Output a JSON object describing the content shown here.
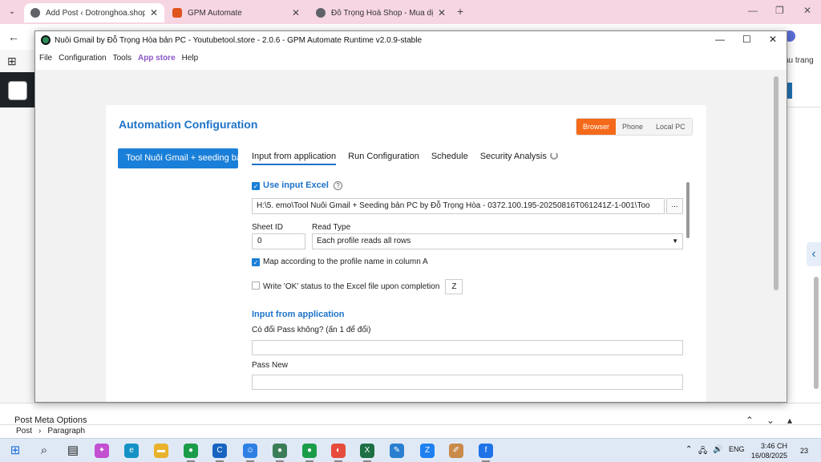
{
  "browser": {
    "tabs": [
      {
        "title": "Add Post ‹ Dotronghoa.shop —",
        "icon_color": "#5f6368",
        "active": true
      },
      {
        "title": "GPM Automate",
        "icon_color": "#e0541d",
        "active": false
      },
      {
        "title": "Đỗ Trọng Hoà Shop - Mua dịch",
        "icon_color": "#5f6368",
        "active": false
      }
    ],
    "new_tab": "+",
    "minimize": "—",
    "maximize": "❐",
    "close": "✕",
    "right_text": "ầu trang"
  },
  "app": {
    "title": "Nuôi Gmail by Đỗ Trọng Hòa bản PC - Youtubetool.store  - 2.0.6 - GPM Automate Runtime v2.0.9-stable",
    "menu": [
      "File",
      "Configuration",
      "Tools",
      "App store",
      "Help"
    ],
    "card_title": "Automation Configuration",
    "modes": [
      {
        "label": "Browser",
        "active": true
      },
      {
        "label": "Phone",
        "active": false
      },
      {
        "label": "Local PC",
        "active": false
      }
    ],
    "tool_button": "Tool Nuôi Gmail + seeding bả",
    "tabs": [
      "Input from application",
      "Run Configuration",
      "Schedule",
      "Security Analysis"
    ],
    "use_excel_label": "Use input Excel",
    "use_excel_checked": true,
    "file_path": "H:\\5. emo\\Tool Nuôi Gmail + Seeding bản PC by Đỗ Trọng Hòa - 0372.100.195-20250816T061241Z-1-001\\Too",
    "browse_button": "...",
    "sheet_id_label": "Sheet ID",
    "sheet_id_value": "0",
    "read_type_label": "Read Type",
    "read_type_value": "Each profile reads all rows",
    "map_label": "Map according to the profile name in column A",
    "map_checked": true,
    "write_ok_label": "Write 'OK' status to the Excel file upon completion",
    "write_ok_checked": false,
    "write_ok_column": "Z",
    "section_title": "Input from application",
    "field1_label": "Có đổi Pass không? (ấn 1 để đổi)",
    "field1_value": "",
    "field2_label": "Pass New",
    "field2_value": ""
  },
  "background": {
    "post_meta": "Post Meta Options",
    "breadcrumb": [
      "Post",
      "Paragraph"
    ]
  },
  "taskbar": {
    "apps": [
      {
        "name": "windows-start",
        "color": "#1e6fd9"
      },
      {
        "name": "search",
        "color": "#1e1e1e"
      },
      {
        "name": "task-view",
        "color": "#1e1e1e"
      },
      {
        "name": "copilot",
        "color": "#c34fd1"
      },
      {
        "name": "edge",
        "color": "#1592c5"
      },
      {
        "name": "file-explorer",
        "color": "#e8b22c"
      },
      {
        "name": "chrome-1",
        "color": "#1a9c48"
      },
      {
        "name": "app-c",
        "color": "#1764c0"
      },
      {
        "name": "people",
        "color": "#2d7fe3"
      },
      {
        "name": "chrome-2",
        "color": "#3b7d57"
      },
      {
        "name": "chrome-3",
        "color": "#1a9c48"
      },
      {
        "name": "color-app",
        "color": "#e64b3b"
      },
      {
        "name": "excel",
        "color": "#1d7044"
      },
      {
        "name": "app-blue",
        "color": "#2a7fd0"
      },
      {
        "name": "zalo",
        "color": "#1e7ff0"
      },
      {
        "name": "app-paint",
        "color": "#c98a4a"
      },
      {
        "name": "app-circle",
        "color": "#1e73e8"
      }
    ],
    "tray_lang": "ENG",
    "time": "3:46 CH",
    "date": "16/08/2025",
    "notifications": "23"
  }
}
